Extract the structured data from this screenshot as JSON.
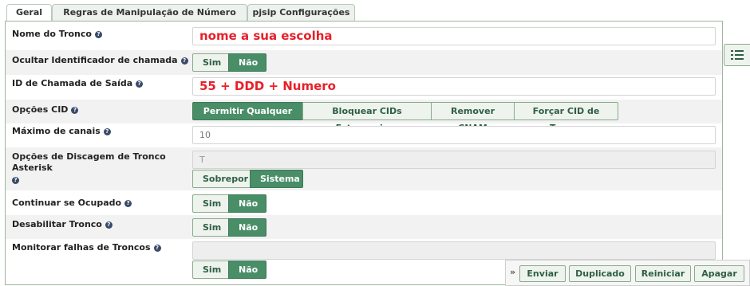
{
  "tabs": [
    {
      "label": "Geral",
      "active": true
    },
    {
      "label": "Regras de Manipulação de Número Discado",
      "active": false
    },
    {
      "label": "pjsip Configurações",
      "active": false
    }
  ],
  "fields": {
    "trunk_name": {
      "label": "Nome do Tronco",
      "value": "nome a sua escolha"
    },
    "hide_caller_id": {
      "label": "Ocultar Identificador de chamada",
      "options": [
        "Sim",
        "Não"
      ],
      "selected": "Não"
    },
    "outbound_cid": {
      "label": "ID de Chamada de Saída",
      "value": "55 + DDD + Numero"
    },
    "cid_options": {
      "label": "Opções CID",
      "options": [
        "Permitir Qualquer CID",
        "Bloquear CIDs Estrangeiros",
        "Remover CNAM",
        "Forçar CID de Tronco"
      ],
      "selected": "Permitir Qualquer CID"
    },
    "max_channels": {
      "label": "Máximo de canais",
      "value": "10"
    },
    "dial_options": {
      "label": "Opções de Discagem de Tronco Asterisk",
      "value": "T",
      "options": [
        "Sobrepor",
        "Sistema"
      ],
      "selected": "Sistema"
    },
    "continue_if_busy": {
      "label": "Continuar se Ocupado",
      "options": [
        "Sim",
        "Não"
      ],
      "selected": "Não"
    },
    "disable_trunk": {
      "label": "Desabilitar Tronco",
      "options": [
        "Sim",
        "Não"
      ],
      "selected": "Não"
    },
    "monitor_failures": {
      "label": "Monitorar falhas de Troncos",
      "value": "",
      "options": [
        "Sim",
        "Não"
      ],
      "selected": "Não"
    }
  },
  "help_icon": "question-circle-icon",
  "side_toggle_icon": "list-icon",
  "action_bar": {
    "chevron": "»",
    "buttons": [
      "Enviar",
      "Duplicado",
      "Reiniciar",
      "Apagar"
    ]
  },
  "colors": {
    "accent": "#4a8e68",
    "button_bg": "#eef3ee",
    "button_border": "#8aab8a",
    "highlight_text": "#e8202a",
    "row_alt": "#f2f2f2"
  }
}
